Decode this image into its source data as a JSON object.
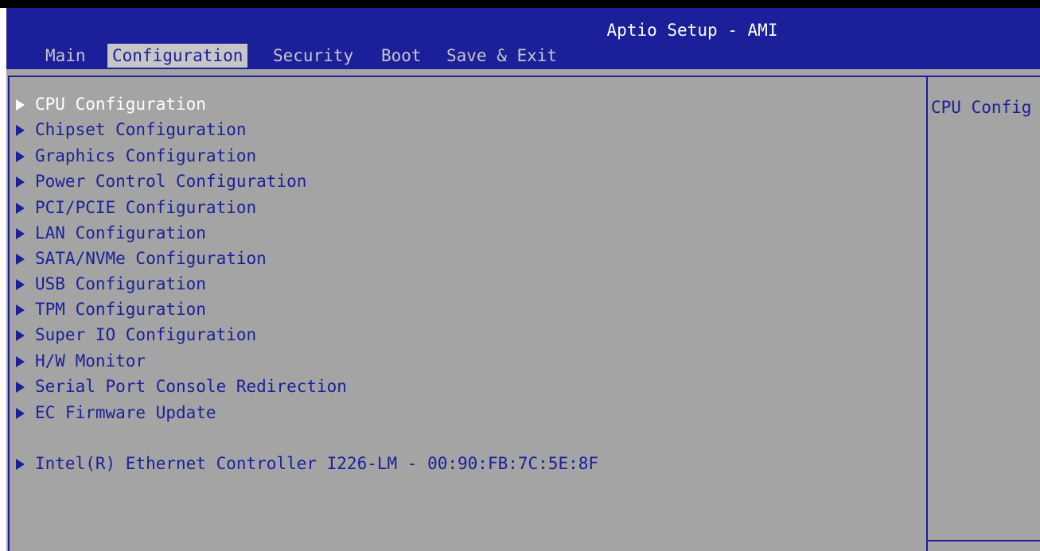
{
  "header": {
    "title": "Aptio Setup - AMI",
    "tabs": [
      {
        "label": "Main"
      },
      {
        "label": "Configuration"
      },
      {
        "label": "Security"
      },
      {
        "label": "Boot"
      },
      {
        "label": "Save & Exit"
      }
    ],
    "active_tab": "Configuration"
  },
  "menu": {
    "items": [
      {
        "label": "CPU Configuration"
      },
      {
        "label": "Chipset Configuration"
      },
      {
        "label": "Graphics Configuration"
      },
      {
        "label": "Power Control Configuration"
      },
      {
        "label": "PCI/PCIE Configuration"
      },
      {
        "label": "LAN Configuration"
      },
      {
        "label": "SATA/NVMe Configuration"
      },
      {
        "label": "USB Configuration"
      },
      {
        "label": "TPM Configuration"
      },
      {
        "label": "Super IO Configuration"
      },
      {
        "label": "H/W Monitor"
      },
      {
        "label": "Serial Port Console Redirection"
      },
      {
        "label": "EC Firmware Update"
      },
      {
        "label": "Intel(R) Ethernet Controller I226-LM - 00:90:FB:7C:5E:8F"
      }
    ],
    "selected": "CPU Configuration"
  },
  "help": {
    "text": "CPU Config"
  },
  "colors": {
    "header_bg": "#1b1f9a",
    "content_bg": "#a4a4a4",
    "active_tab_bg": "#c6c6c6",
    "text": "#1b1f9a",
    "selected_text": "#ffffff"
  },
  "icons": {
    "submenu": "submenu-arrow-icon"
  }
}
